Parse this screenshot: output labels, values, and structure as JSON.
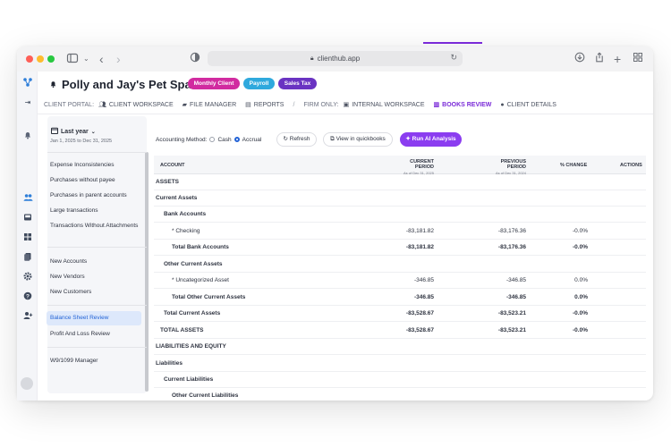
{
  "browser": {
    "url": "clienthub.app"
  },
  "header": {
    "client_name": "Polly and Jay's Pet Spa",
    "tags": {
      "monthly": "Monthly Client",
      "payroll": "Payroll",
      "sales_tax": "Sales Tax"
    },
    "client_portal_label": "CLIENT PORTAL:",
    "firm_only_label": "FIRM ONLY:",
    "separator": "/",
    "nav": {
      "client_workspace": "CLIENT WORKSPACE",
      "file_manager": "FILE MANAGER",
      "reports": "REPORTS",
      "internal_workspace": "INTERNAL WORKSPACE",
      "books_review": "BOOKS REVIEW",
      "client_details": "CLIENT DETAILS"
    }
  },
  "sidebar": {
    "period_label": "Last year",
    "period_range": "Jan 1, 2025 to Dec 31, 2025",
    "items": [
      "Expense Inconsistencies",
      "Purchases without payee",
      "Purchases in parent accounts",
      "Large transactions",
      "Transactions Without Attachments",
      "New Accounts",
      "New Vendors",
      "New Customers",
      "Balance Sheet Review",
      "Profit And Loss Review",
      "W9/1099 Manager"
    ],
    "active_index": 8
  },
  "toolbar": {
    "accounting_method_label": "Accounting Method:",
    "cash_label": "Cash",
    "accrual_label": "Accrual",
    "selected_method": "Accrual",
    "refresh_label": "Refresh",
    "quickbooks_label": "View in quickbooks",
    "ai_label": "Run AI Analysis"
  },
  "table": {
    "headers": {
      "account": "ACCOUNT",
      "current": "CURRENT PERIOD",
      "current_sub": "As of Dec 31, 2025",
      "previous": "PREVIOUS PERIOD",
      "previous_sub": "As of Dec 31, 2024",
      "change": "% CHANGE",
      "actions": "ACTIONS"
    },
    "rows": [
      {
        "account": "ASSETS",
        "current": "",
        "previous": "",
        "change": ""
      },
      {
        "account": "Current Assets",
        "current": "",
        "previous": "",
        "change": ""
      },
      {
        "account": "Bank Accounts",
        "current": "",
        "previous": "",
        "change": ""
      },
      {
        "account": "* Checking",
        "current": "-83,181.82",
        "previous": "-83,176.36",
        "change": "-0.0%"
      },
      {
        "account": "Total Bank Accounts",
        "current": "-83,181.82",
        "previous": "-83,176.36",
        "change": "-0.0%"
      },
      {
        "account": "Other Current Assets",
        "current": "",
        "previous": "",
        "change": ""
      },
      {
        "account": "* Uncategorized Asset",
        "current": "-346.85",
        "previous": "-346.85",
        "change": "0.0%"
      },
      {
        "account": "Total Other Current Assets",
        "current": "-346.85",
        "previous": "-346.85",
        "change": "0.0%"
      },
      {
        "account": "Total Current Assets",
        "current": "-83,528.67",
        "previous": "-83,523.21",
        "change": "-0.0%"
      },
      {
        "account": "TOTAL ASSETS",
        "current": "-83,528.67",
        "previous": "-83,523.21",
        "change": "-0.0%"
      },
      {
        "account": "LIABILITIES AND EQUITY",
        "current": "",
        "previous": "",
        "change": ""
      },
      {
        "account": "Liabilities",
        "current": "",
        "previous": "",
        "change": ""
      },
      {
        "account": "Current Liabilities",
        "current": "",
        "previous": "",
        "change": ""
      },
      {
        "account": "Other Current Liabilities",
        "current": "",
        "previous": "",
        "change": ""
      }
    ]
  }
}
